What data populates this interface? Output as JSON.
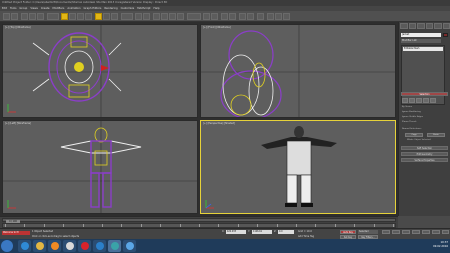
{
  "window": {
    "title": "Untitled     Project Folder: C:\\Users\\abell123\\Documents\\3dsmax      Autodesk 3ds Max 2013      Unregistered Version      Display : Direct 3D"
  },
  "menu": [
    "Edit",
    "Tools",
    "Group",
    "Views",
    "Create",
    "Modifiers",
    "Animation",
    "Graph Editors",
    "Rendering",
    "Customize",
    "MAXScript",
    "Help"
  ],
  "viewports": [
    {
      "label": "[+] [Top] [Wireframe]"
    },
    {
      "label": "[+] [Front] [Wireframe]"
    },
    {
      "label": "[+] [Left] [Wireframe]"
    },
    {
      "label": "[+] [Perspective] [Shaded]"
    }
  ],
  "command_panel": {
    "object_name": "Jacket",
    "modifier_list": "Modifier List",
    "stack_item": "Editable Mesh",
    "rollout_selection": "Selection",
    "rollout_soft_selection": "Soft Selection",
    "rollout_edit_geometry": "Edit Geometry",
    "options": [
      "By Vertex",
      "Ignore Backfacing",
      "Ignore Visible Edges",
      "Planar Thresh"
    ],
    "named_selections": "Named Selections:",
    "copy_label": "Copy",
    "paste_label": "Paste",
    "whole_object_label": "Whole Object Selected",
    "surface_properties": "Surface Properties"
  },
  "timeline": {
    "frame_readout": "0 / 100",
    "frame": 0,
    "total_frames": 100
  },
  "status": {
    "selection": "1 Object Selected",
    "prompt": "Click or click-and-drag to select objects",
    "script_listener": "Welcome to M",
    "x_label": "X:",
    "x_value": "422.033",
    "y_label": "Y:",
    "y_value": "1126.61",
    "z_label": "Z:",
    "z_value": "0.0",
    "grid": "Grid = 10.0",
    "add_time_tag": "Add Time Tag",
    "auto_key": "Auto Key",
    "set_key": "Set Key",
    "selected_dropdown": "Selected",
    "key_filters": "Key Filters..."
  },
  "taskbar": {
    "time": "10:37",
    "date": "09.02.2016",
    "apps": [
      {
        "icon": "ie-icon",
        "color": "#2f8ad6"
      },
      {
        "icon": "folder-icon",
        "color": "#e1b643"
      },
      {
        "icon": "media-player-icon",
        "color": "#f08a24"
      },
      {
        "icon": "chrome-icon",
        "color": "#d9d9d9"
      },
      {
        "icon": "opera-icon",
        "color": "#d8232a"
      },
      {
        "icon": "photoshop-icon",
        "color": "#2b7fc9"
      },
      {
        "icon": "3dsmax-icon",
        "color": "#3aa3a8"
      },
      {
        "icon": "windows-icon",
        "color": "#5aa6e6"
      }
    ]
  },
  "colors": {
    "active_viewport": "#e6d23a",
    "wire_purple": "#8b3ec9",
    "wire_white": "#f0f0f0",
    "highlight_yellow": "#e2b616"
  }
}
